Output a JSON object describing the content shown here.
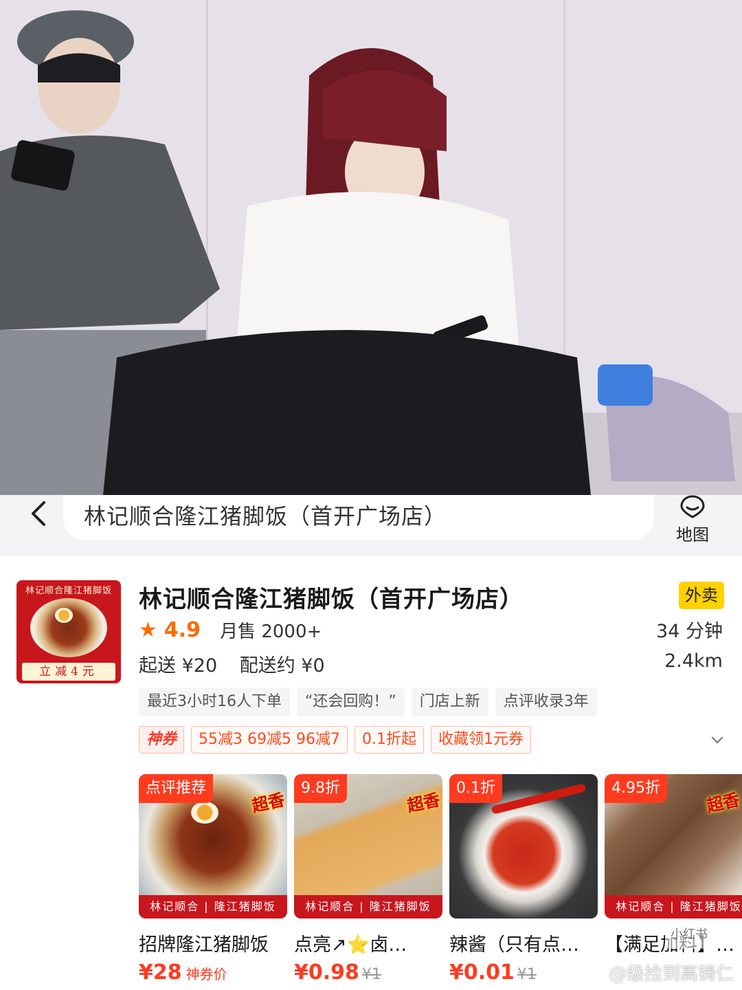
{
  "header": {
    "search_text": "林记顺合隆江猪脚饭（首开广场店）",
    "map_label": "地图"
  },
  "store": {
    "logo_title": "林记顺合隆江猪脚饭",
    "logo_banner": "立减4元",
    "name": "林记顺合隆江猪脚饭（首开广场店）",
    "service_tag": "外卖",
    "rating": "4.9",
    "monthly_sales": "月售 2000+",
    "delivery_time": "34 分钟",
    "min_order": "起送 ¥20",
    "delivery_fee": "配送约 ¥0",
    "distance": "2.4km",
    "highlights": [
      "最近3小时16人下单",
      "“还会回购！”",
      "门店上新",
      "点评收录3年"
    ],
    "coupons": [
      "神券",
      "55减3  69减5  96减7",
      "0.1折起",
      "收藏领1元券"
    ]
  },
  "dishes": [
    {
      "badge": "点评推荐",
      "stamp": "超香",
      "strip": "林记顺合 | 隆江猪脚饭",
      "name": "招牌隆江猪脚饭",
      "price": "¥28",
      "note": "神券价",
      "original": ""
    },
    {
      "badge": "9.8折",
      "stamp": "超香",
      "strip": "林记顺合 | 隆江猪脚饭",
      "name": "点亮↗⭐卤…",
      "price": "¥0.98",
      "note": "",
      "original": "¥1"
    },
    {
      "badge": "0.1折",
      "stamp": "",
      "strip": "",
      "name": "辣酱（只有点…",
      "price": "¥0.01",
      "note": "",
      "original": "¥1"
    },
    {
      "badge": "4.95折",
      "stamp": "超香",
      "strip": "林记顺合 | 隆江猪脚饭",
      "name": "【满足加料】…",
      "price": "",
      "note": "",
      "original": ""
    }
  ],
  "watermark": "@级捡到高铸仁",
  "watermark_badge": "小红书",
  "colors": {
    "accent_orange": "#ff6a00",
    "price_red": "#ff3b1f",
    "brand_red": "#c8161d",
    "takeout_yellow": "#ffd100"
  },
  "icons": [
    "back-arrow-icon",
    "map-pin-icon",
    "star-icon",
    "chevron-down-icon"
  ]
}
